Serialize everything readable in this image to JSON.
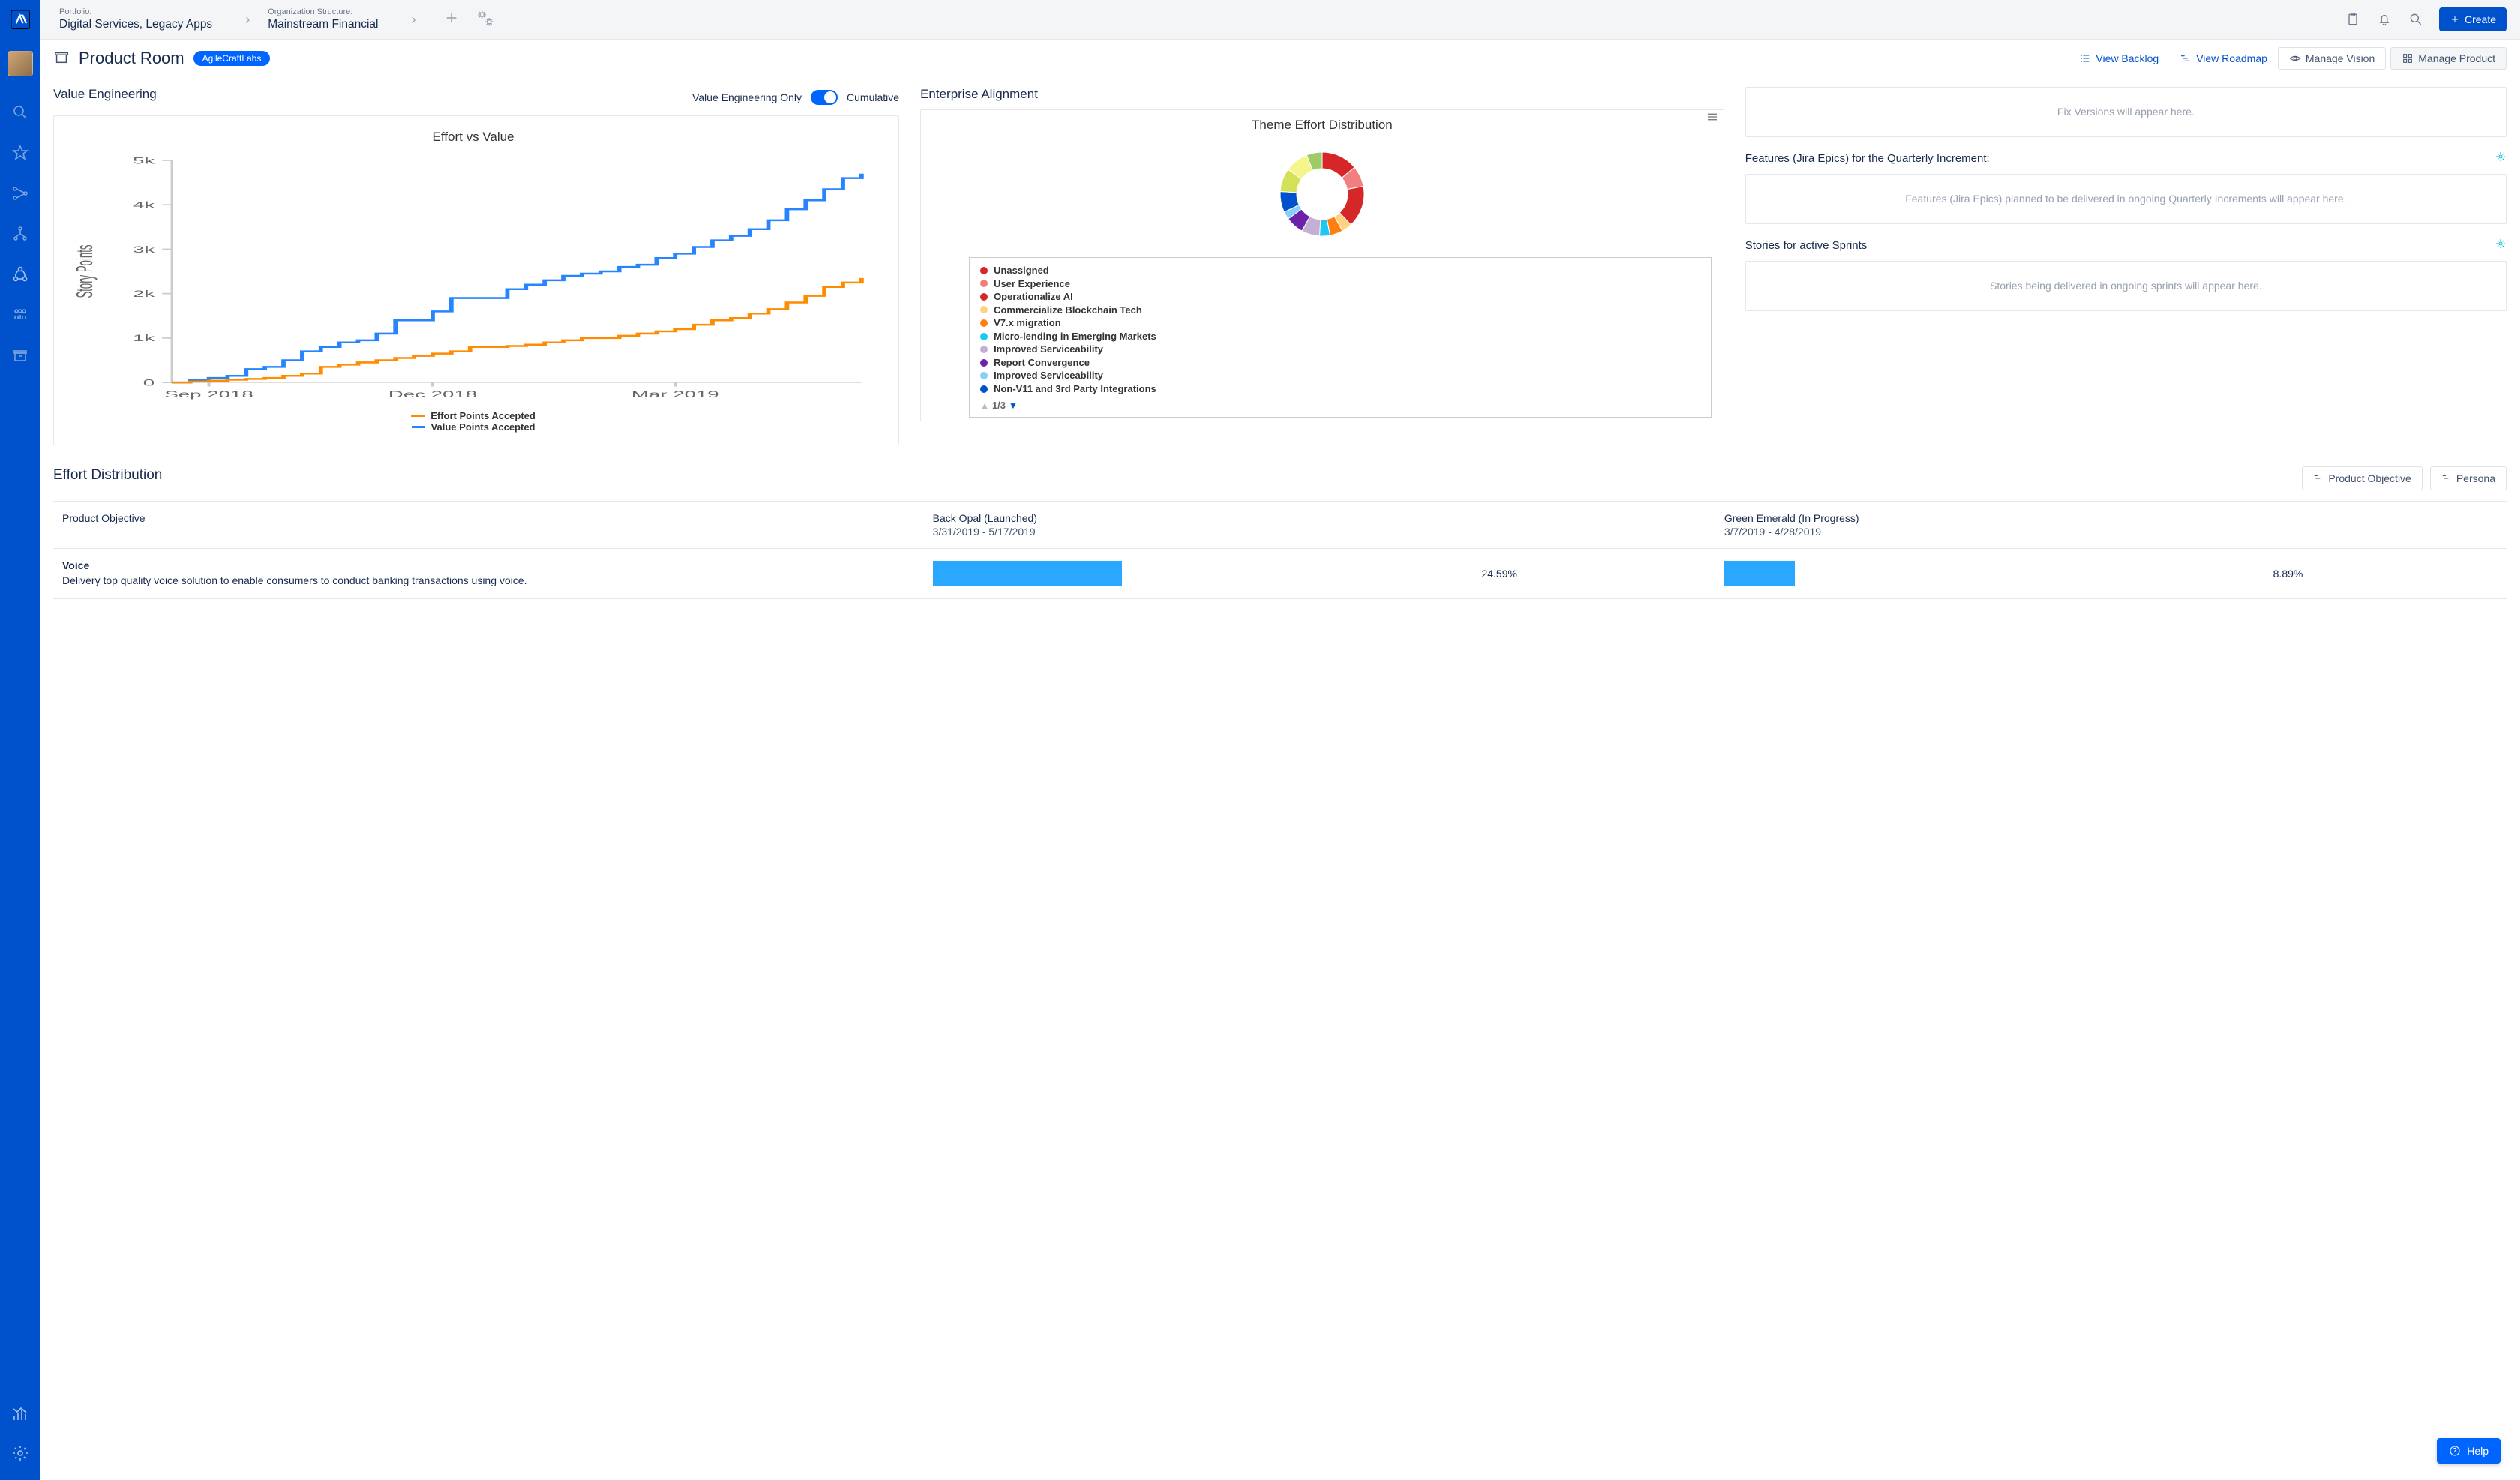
{
  "breadcrumb": {
    "portfolio_label": "Portfolio:",
    "portfolio_value": "Digital Services, Legacy Apps",
    "org_label": "Organization Structure:",
    "org_value": "Mainstream Financial"
  },
  "header": {
    "create": "Create"
  },
  "page": {
    "title": "Product Room",
    "badge": "AgileCraftLabs",
    "view_backlog": "View Backlog",
    "view_roadmap": "View Roadmap",
    "manage_vision": "Manage Vision",
    "manage_product": "Manage Product"
  },
  "value_eng": {
    "title": "Value Engineering",
    "toggle_left": "Value Engineering Only",
    "toggle_right": "Cumulative",
    "chart_title": "Effort vs Value",
    "ylabel": "Story Points",
    "legend_effort": "Effort Points Accepted",
    "legend_value": "Value Points Accepted",
    "xticks": [
      "Sep 2018",
      "Dec 2018",
      "Mar 2019"
    ]
  },
  "ent_align": {
    "title": "Enterprise Alignment",
    "chart_title": "Theme Effort Distribution",
    "pager": "1/3"
  },
  "themes": [
    {
      "label": "Unassigned",
      "color": "#d62728",
      "value": 14
    },
    {
      "label": "User Experience",
      "color": "#f08080",
      "value": 8
    },
    {
      "label": "Operationalize AI",
      "color": "#d62728",
      "value": 16
    },
    {
      "label": "Commercialize Blockchain Tech",
      "color": "#ffd27f",
      "value": 4
    },
    {
      "label": "V7.x migration",
      "color": "#ff7f0e",
      "value": 5
    },
    {
      "label": "Micro-lending in Emerging Markets",
      "color": "#1cc7f2",
      "value": 4
    },
    {
      "label": "Improved Serviceability",
      "color": "#c5b0d5",
      "value": 7
    },
    {
      "label": "Report Convergence",
      "color": "#6b21a8",
      "value": 7
    },
    {
      "label": "Improved Serviceability",
      "color": "#87cefa",
      "value": 3
    },
    {
      "label": "Non-V11 and 3rd Party Integrations",
      "color": "#0052cc",
      "value": 8
    },
    {
      "label": "",
      "color": "#d4e157",
      "value": 9
    },
    {
      "label": "",
      "color": "#f5f58c",
      "value": 9
    },
    {
      "label": "",
      "color": "#9ccc65",
      "value": 6
    }
  ],
  "side": {
    "fix_versions": "Fix Versions will appear here.",
    "features_title": "Features (Jira Epics) for the Quarterly Increment:",
    "features_placeholder": "Features (Jira Epics) planned to be delivered in ongoing Quarterly Increments will appear here.",
    "stories_title": "Stories for active Sprints",
    "stories_placeholder": "Stories being delivered in ongoing sprints will appear here."
  },
  "dist": {
    "title": "Effort Distribution",
    "btn_objective": "Product Objective",
    "btn_persona": "Persona",
    "col_objective": "Product Objective",
    "col1_name": "Back Opal (Launched)",
    "col1_dates": "3/31/2019 - 5/17/2019",
    "col2_name": "Green Emerald (In Progress)",
    "col2_dates": "3/7/2019 - 4/28/2019",
    "obj1_title": "Voice",
    "obj1_desc": "Delivery top quality voice solution to enable consumers to conduct banking transactions using voice.",
    "val1": "24.59%",
    "val2": "8.89%"
  },
  "help": {
    "label": "Help"
  },
  "chart_data": {
    "type": "line",
    "title": "Effort vs Value",
    "ylabel": "Story Points",
    "ylim": [
      0,
      5000
    ],
    "xticks": [
      "Sep 2018",
      "Dec 2018",
      "Mar 2019"
    ],
    "yticks": [
      0,
      1000,
      2000,
      3000,
      4000,
      5000
    ],
    "x": [
      0,
      1,
      2,
      3,
      4,
      5,
      6,
      7,
      8,
      9,
      10,
      11,
      12,
      13,
      14,
      15,
      16,
      17,
      18,
      19,
      20,
      21,
      22,
      23,
      24,
      25,
      26,
      27,
      28,
      29,
      30,
      31,
      32,
      33,
      34,
      35,
      36,
      37
    ],
    "series": [
      {
        "name": "Value Points Accepted",
        "color": "#2684FF",
        "values": [
          0,
          50,
          100,
          150,
          300,
          350,
          500,
          700,
          800,
          900,
          950,
          1100,
          1400,
          1400,
          1600,
          1900,
          1900,
          1900,
          2100,
          2200,
          2300,
          2400,
          2450,
          2500,
          2600,
          2650,
          2800,
          2900,
          3050,
          3200,
          3300,
          3450,
          3650,
          3900,
          4100,
          4350,
          4600,
          4700
        ]
      },
      {
        "name": "Effort Points Accepted",
        "color": "#FF8B00",
        "values": [
          0,
          20,
          40,
          60,
          80,
          100,
          150,
          200,
          350,
          400,
          450,
          500,
          550,
          600,
          650,
          700,
          800,
          800,
          820,
          850,
          900,
          950,
          1000,
          1000,
          1050,
          1100,
          1150,
          1200,
          1300,
          1400,
          1450,
          1550,
          1650,
          1800,
          1950,
          2150,
          2250,
          2350
        ]
      }
    ]
  }
}
